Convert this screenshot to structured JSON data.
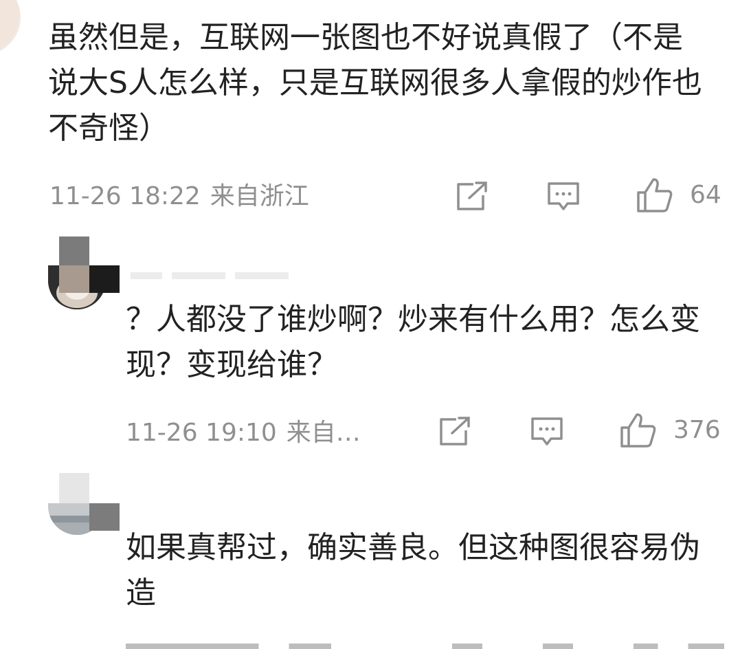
{
  "comments": [
    {
      "text": "虽然但是，互联网一张图也不好说真假了（不是说大S人怎么样，只是互联网很多人拿假的炒作也不奇怪）",
      "date": "11-26 18:22",
      "location": "来自浙江",
      "likes": "64"
    },
    {
      "text": "？人都没了谁炒啊？炒来有什么用？怎么变现？变现给谁？",
      "date": "11-26 19:10",
      "location": "来自…",
      "likes": "376"
    },
    {
      "text": "如果真帮过，确实善良。但这种图很容易伪造"
    }
  ],
  "icons": {
    "share": "share-icon",
    "reply": "comment-icon",
    "like": "thumb-up-icon"
  },
  "colors": {
    "text": "#222222",
    "meta": "#8f8f8f",
    "icon": "#8f8f8f"
  }
}
